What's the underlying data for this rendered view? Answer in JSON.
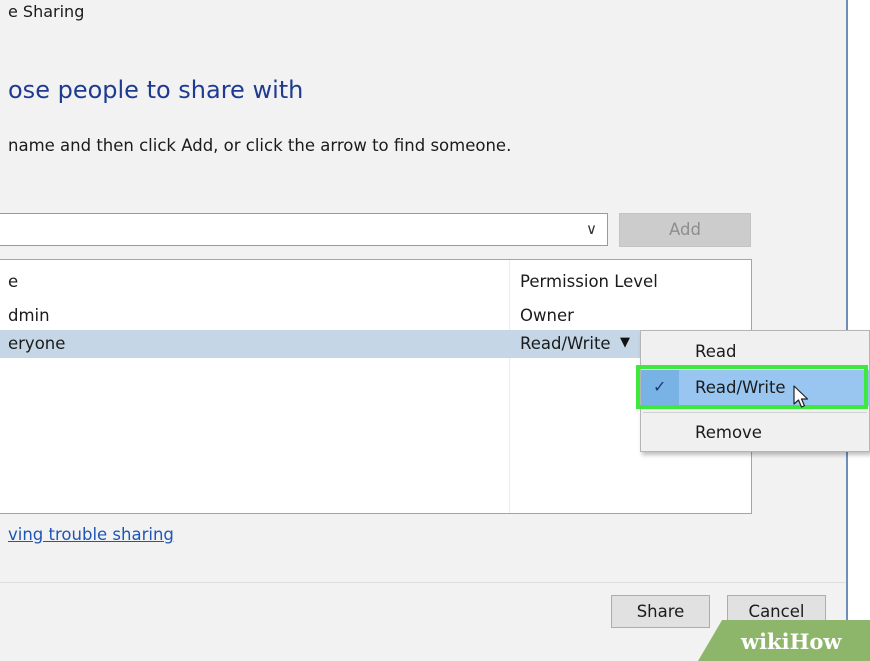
{
  "window": {
    "title": "e Sharing"
  },
  "heading": "ose people to share with",
  "instruction": "name and then click Add, or click the arrow to find someone.",
  "combo": {
    "value": "",
    "arrow_icon": "chevron-down-icon",
    "arrow_glyph": "∨"
  },
  "add_button": {
    "label": "Add",
    "enabled": false
  },
  "table": {
    "columns": [
      "e",
      "Permission Level"
    ],
    "rows": [
      {
        "name": "dmin",
        "permission": "Owner",
        "selected": false
      },
      {
        "name": "eryone",
        "permission": "Read/Write",
        "selected": true,
        "dropdown_glyph": "▼"
      }
    ]
  },
  "permission_menu": {
    "items": [
      {
        "label": "Read",
        "checked": false
      },
      {
        "label": "Read/Write",
        "checked": true
      },
      {
        "label": "Remove",
        "checked": false
      }
    ],
    "check_glyph": "✓"
  },
  "trouble_link": "ving trouble sharing",
  "buttons": {
    "share": "Share",
    "cancel": "Cancel"
  },
  "watermark": "wikiHow",
  "colors": {
    "heading": "#1f3b91",
    "selection": "#c5d6e6",
    "menu_highlight": "#99c6f0",
    "highlight_frame": "#3ee83e",
    "link": "#1f56b4"
  }
}
